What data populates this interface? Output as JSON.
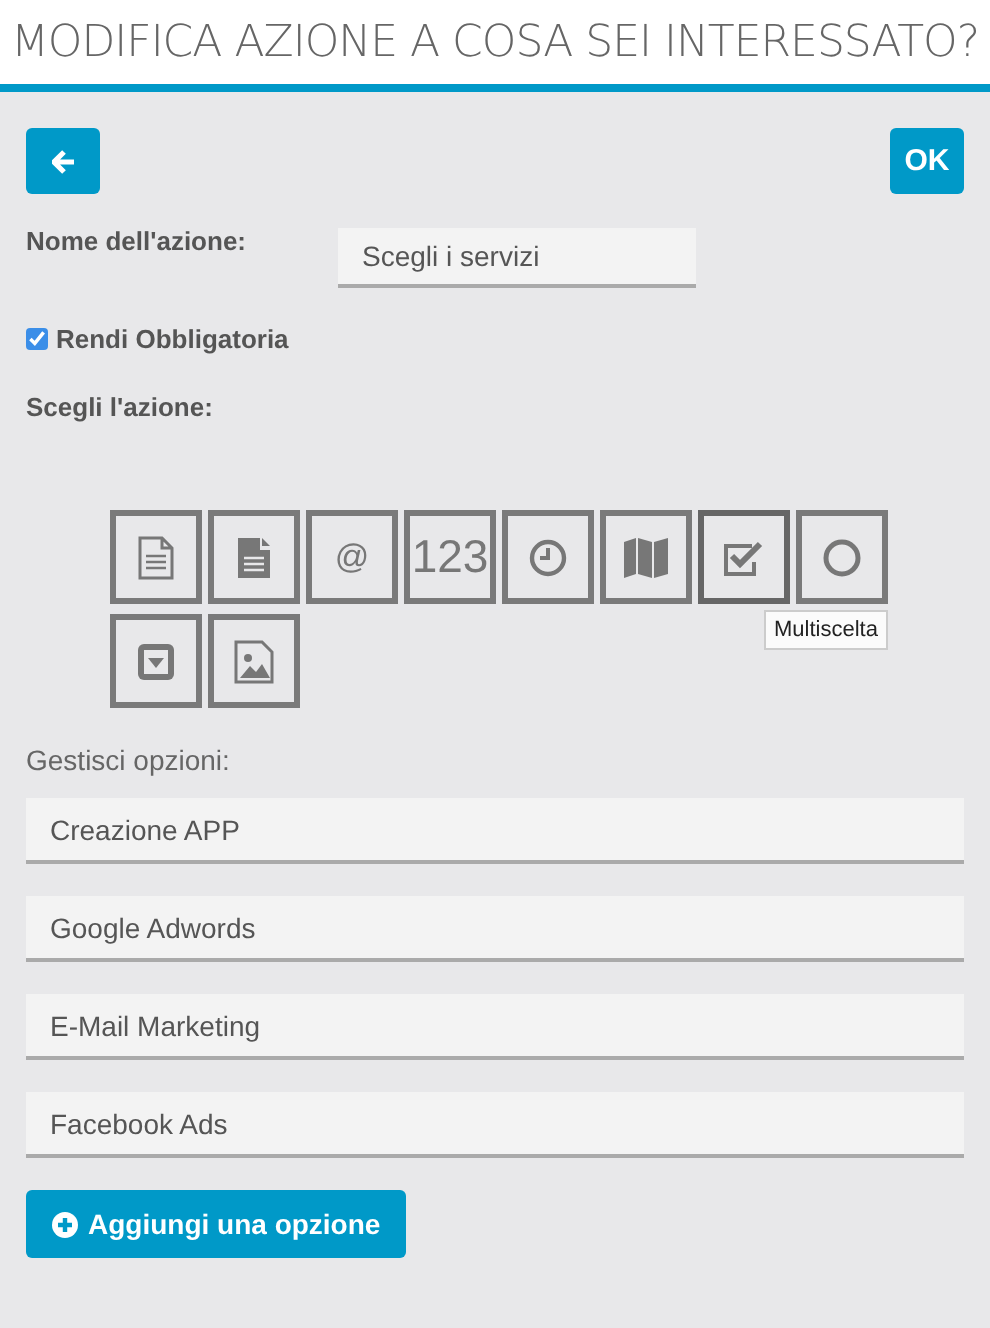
{
  "window": {
    "title": "MODIFICA AZIONE A COSA SEI INTERESSATO?"
  },
  "toolbar": {
    "ok_label": "OK"
  },
  "name_field": {
    "label": "Nome dell'azione:",
    "value": "Scegli i servizi"
  },
  "required": {
    "label": "Rendi Obbligatoria",
    "checked": true
  },
  "actions_label": "Scegli l'azione:",
  "actions": [
    {
      "kind": "text",
      "selected": false
    },
    {
      "kind": "document",
      "selected": false
    },
    {
      "kind": "email",
      "selected": false,
      "glyph": "@"
    },
    {
      "kind": "number",
      "selected": false,
      "glyph": "123"
    },
    {
      "kind": "time",
      "selected": false
    },
    {
      "kind": "map",
      "selected": false
    },
    {
      "kind": "checkbox",
      "selected": true,
      "tooltip": "Multiscelta"
    },
    {
      "kind": "radio",
      "selected": false
    },
    {
      "kind": "dropdown",
      "selected": false
    },
    {
      "kind": "image",
      "selected": false
    }
  ],
  "options_label": "Gestisci opzioni:",
  "options": [
    {
      "value": "Creazione APP"
    },
    {
      "value": "Google Adwords"
    },
    {
      "value": "E-Mail Marketing"
    },
    {
      "value": "Facebook Ads"
    }
  ],
  "add_button": {
    "label": "Aggiungi una opzione"
  }
}
